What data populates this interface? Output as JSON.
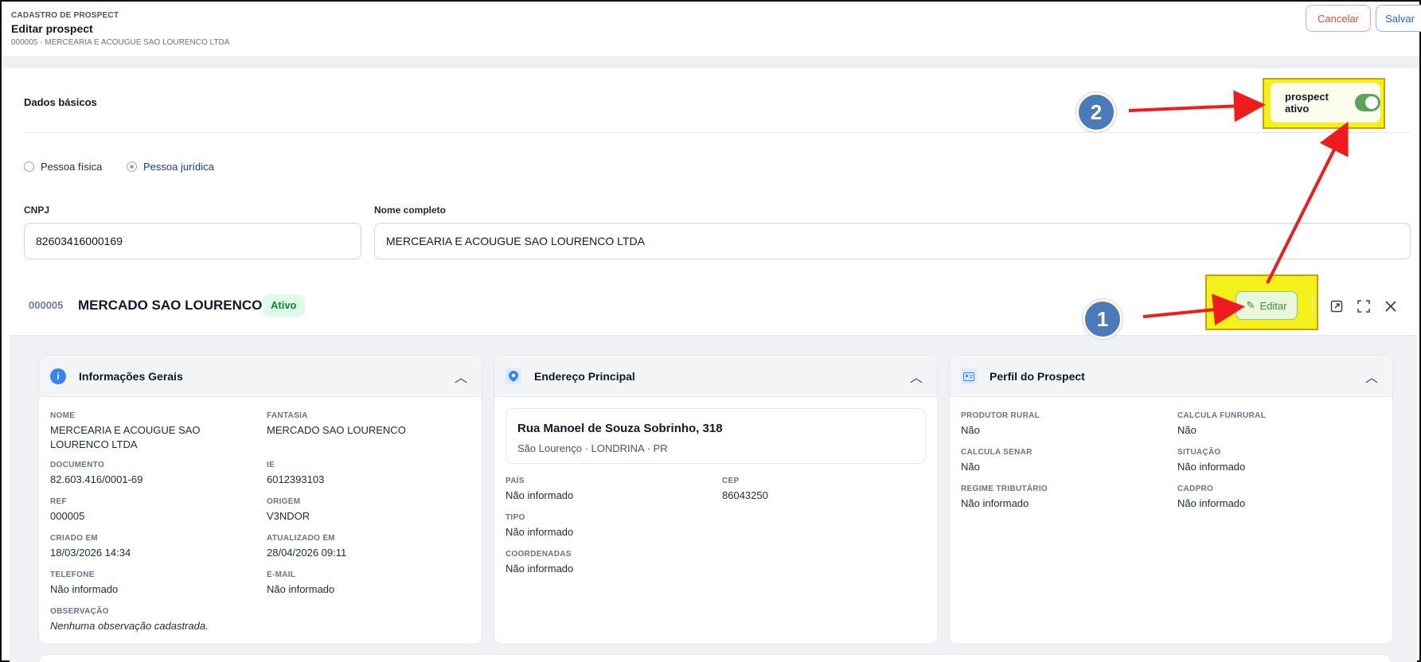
{
  "header": {
    "breadcrumb": "CADASTRO DE PROSPECT",
    "title": "Editar prospect",
    "subtitle": "000005 · MERCEARIA E ACOUGUE SAO LOURENCO LTDA",
    "cancel_label": "Cancelar",
    "save_label": "Salvar"
  },
  "form": {
    "section_title": "Dados básicos",
    "active_toggle_label": "prospect ativo",
    "active_toggle_on": true,
    "person_type_options": [
      "Pessoa física",
      "Pessoa jurídica"
    ],
    "person_type_selected": "Pessoa jurídica",
    "cnpj_label": "CNPJ",
    "cnpj_value": "82603416000169",
    "name_label": "Nome completo",
    "name_value": "MERCEARIA E ACOUGUE SAO LOURENCO LTDA"
  },
  "drawer": {
    "code": "000005",
    "title": "MERCADO SAO LOURENCO",
    "status_badge": "Ativo",
    "edit_label": "Editar",
    "icons": [
      "expand-icon",
      "fullscreen-icon",
      "close-icon"
    ]
  },
  "cards": {
    "general": {
      "title": "Informações Gerais",
      "fields": [
        {
          "key": "NOME",
          "value": "MERCEARIA E ACOUGUE SAO LOURENCO LTDA"
        },
        {
          "key": "FANTASIA",
          "value": "MERCADO SAO LOURENCO"
        },
        {
          "key": "DOCUMENTO",
          "value": "82.603.416/0001-69"
        },
        {
          "key": "IE",
          "value": "6012393103"
        },
        {
          "key": "REF",
          "value": "000005"
        },
        {
          "key": "ORIGEM",
          "value": "V3NDOR"
        },
        {
          "key": "CRIADO EM",
          "value": "18/03/2026 14:34"
        },
        {
          "key": "ATUALIZADO EM",
          "value": "28/04/2026 09:11"
        },
        {
          "key": "TELEFONE",
          "value": "Não informado"
        },
        {
          "key": "E-MAIL",
          "value": "Não informado"
        },
        {
          "key": "OBSERVAÇÃO",
          "value": "Nenhuma observação cadastrada."
        }
      ]
    },
    "address": {
      "title": "Endereço Principal",
      "street": "Rua Manoel de Souza Sobrinho, 318",
      "city_line": "São Lourenço · LONDRINA · PR",
      "fields": [
        {
          "key": "PAÍS",
          "value": "Não informado"
        },
        {
          "key": "CEP",
          "value": "86043250"
        },
        {
          "key": "TIPO",
          "value": "Não informado"
        },
        {
          "key": "COORDENADAS",
          "value": "Não informado"
        }
      ]
    },
    "profile": {
      "title": "Perfil do Prospect",
      "fields": [
        {
          "key": "PRODUTOR RURAL",
          "value": "Não"
        },
        {
          "key": "CALCULA FUNRURAL",
          "value": "Não"
        },
        {
          "key": "CALCULA SENAR",
          "value": "Não"
        },
        {
          "key": "SITUAÇÃO",
          "value": "Não informado"
        },
        {
          "key": "REGIME TRIBUTÁRIO",
          "value": "Não informado"
        },
        {
          "key": "CADPRO",
          "value": "Não informado"
        }
      ]
    }
  },
  "annotations": {
    "step_1": "1",
    "step_2": "2",
    "highlight_color": "#f4f01a",
    "arrow_color": "#ee1c1c",
    "badge_color": "#4a7ab8"
  }
}
